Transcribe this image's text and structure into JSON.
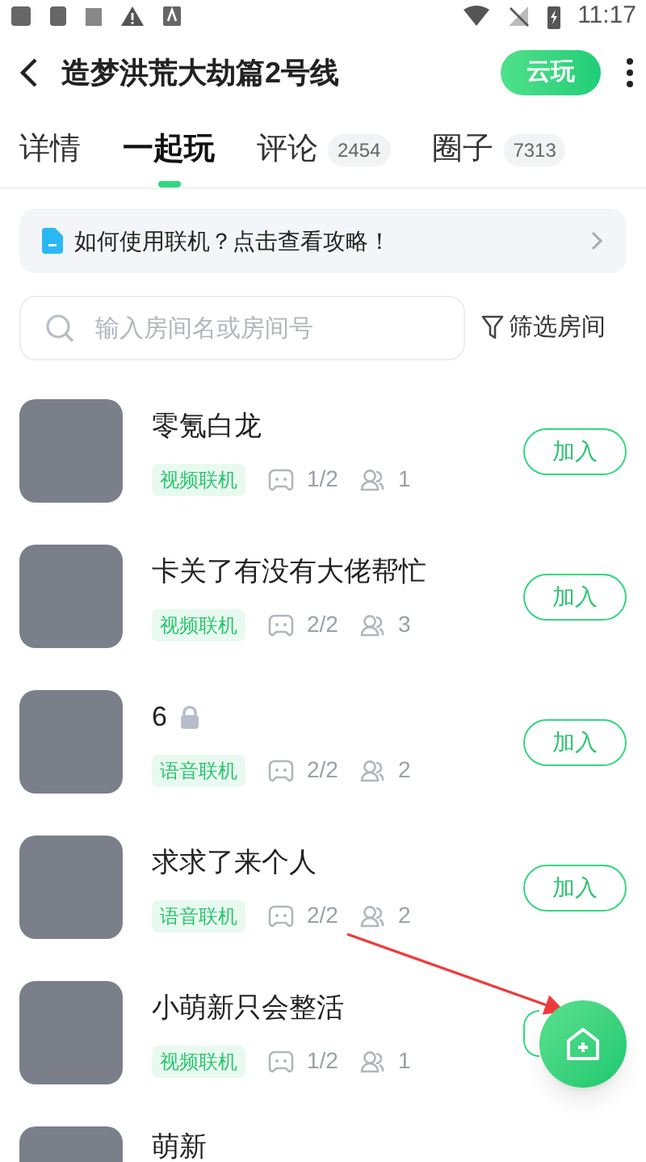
{
  "status_bar": {
    "time": "11:17"
  },
  "header": {
    "title": "造梦洪荒大劫篇2号线",
    "cloud_button": "云玩"
  },
  "tabs": [
    {
      "label": "详情",
      "selected": false
    },
    {
      "label": "一起玩",
      "selected": true
    },
    {
      "label": "评论",
      "count": "2454",
      "selected": false
    },
    {
      "label": "圈子",
      "count": "7313",
      "selected": false
    }
  ],
  "tip": {
    "text": "如何使用联机？点击查看攻略！"
  },
  "search": {
    "placeholder": "输入房间名或房间号"
  },
  "filter": {
    "label": "筛选房间"
  },
  "rooms": [
    {
      "name": "零氪白龙",
      "locked": false,
      "tag": "视频联机",
      "slots": "1/2",
      "members": "1",
      "join": "加入"
    },
    {
      "name": "卡关了有没有大佬帮忙",
      "locked": false,
      "tag": "视频联机",
      "slots": "2/2",
      "members": "3",
      "join": "加入"
    },
    {
      "name": "6",
      "locked": true,
      "tag": "语音联机",
      "slots": "2/2",
      "members": "2",
      "join": "加入"
    },
    {
      "name": "求求了来个人",
      "locked": false,
      "tag": "语音联机",
      "slots": "2/2",
      "members": "2",
      "join": "加入"
    },
    {
      "name": "小萌新只会整活",
      "locked": false,
      "tag": "视频联机",
      "slots": "1/2",
      "members": "1"
    },
    {
      "name": "萌新",
      "locked": false
    }
  ]
}
